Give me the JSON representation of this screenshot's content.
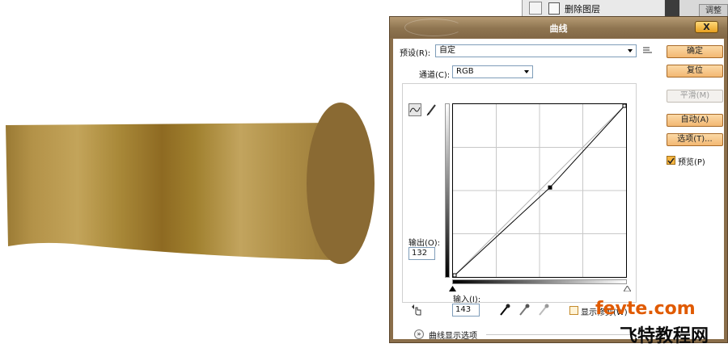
{
  "layers_panel": {
    "item_label": "删除图层",
    "tab_label": "调整"
  },
  "dialog": {
    "title": "曲线",
    "close_label": "X",
    "preset_label": "预设(R):",
    "preset_value": "自定",
    "channel_label": "通道(C):",
    "channel_value": "RGB",
    "output_label": "输出(O):",
    "output_value": "132",
    "input_label": "输入(I):",
    "input_value": "143",
    "show_clipping_label": "显示修剪(W)",
    "curve_options_label": "曲线显示选项",
    "buttons": {
      "ok": "确定",
      "reset": "复位",
      "smooth": "平滑(M)",
      "auto": "自动(A)",
      "options": "选项(T)..."
    },
    "preview_label": "预览(P)",
    "preview_checked": true,
    "show_clipping_checked": false
  },
  "curve": {
    "point": {
      "input": 143,
      "output": 132
    },
    "range": [
      0,
      255
    ]
  },
  "watermark": {
    "site": "fevte.com",
    "name": "飞特教程网"
  },
  "colors": {
    "gold_dark": "#8a6a30",
    "gold_light": "#b8984f",
    "ellipse": "#8a6a33",
    "dialog_frame": "#8a6e4a",
    "button_orange": "#f3b873",
    "watermark_orange": "#e05a00"
  }
}
